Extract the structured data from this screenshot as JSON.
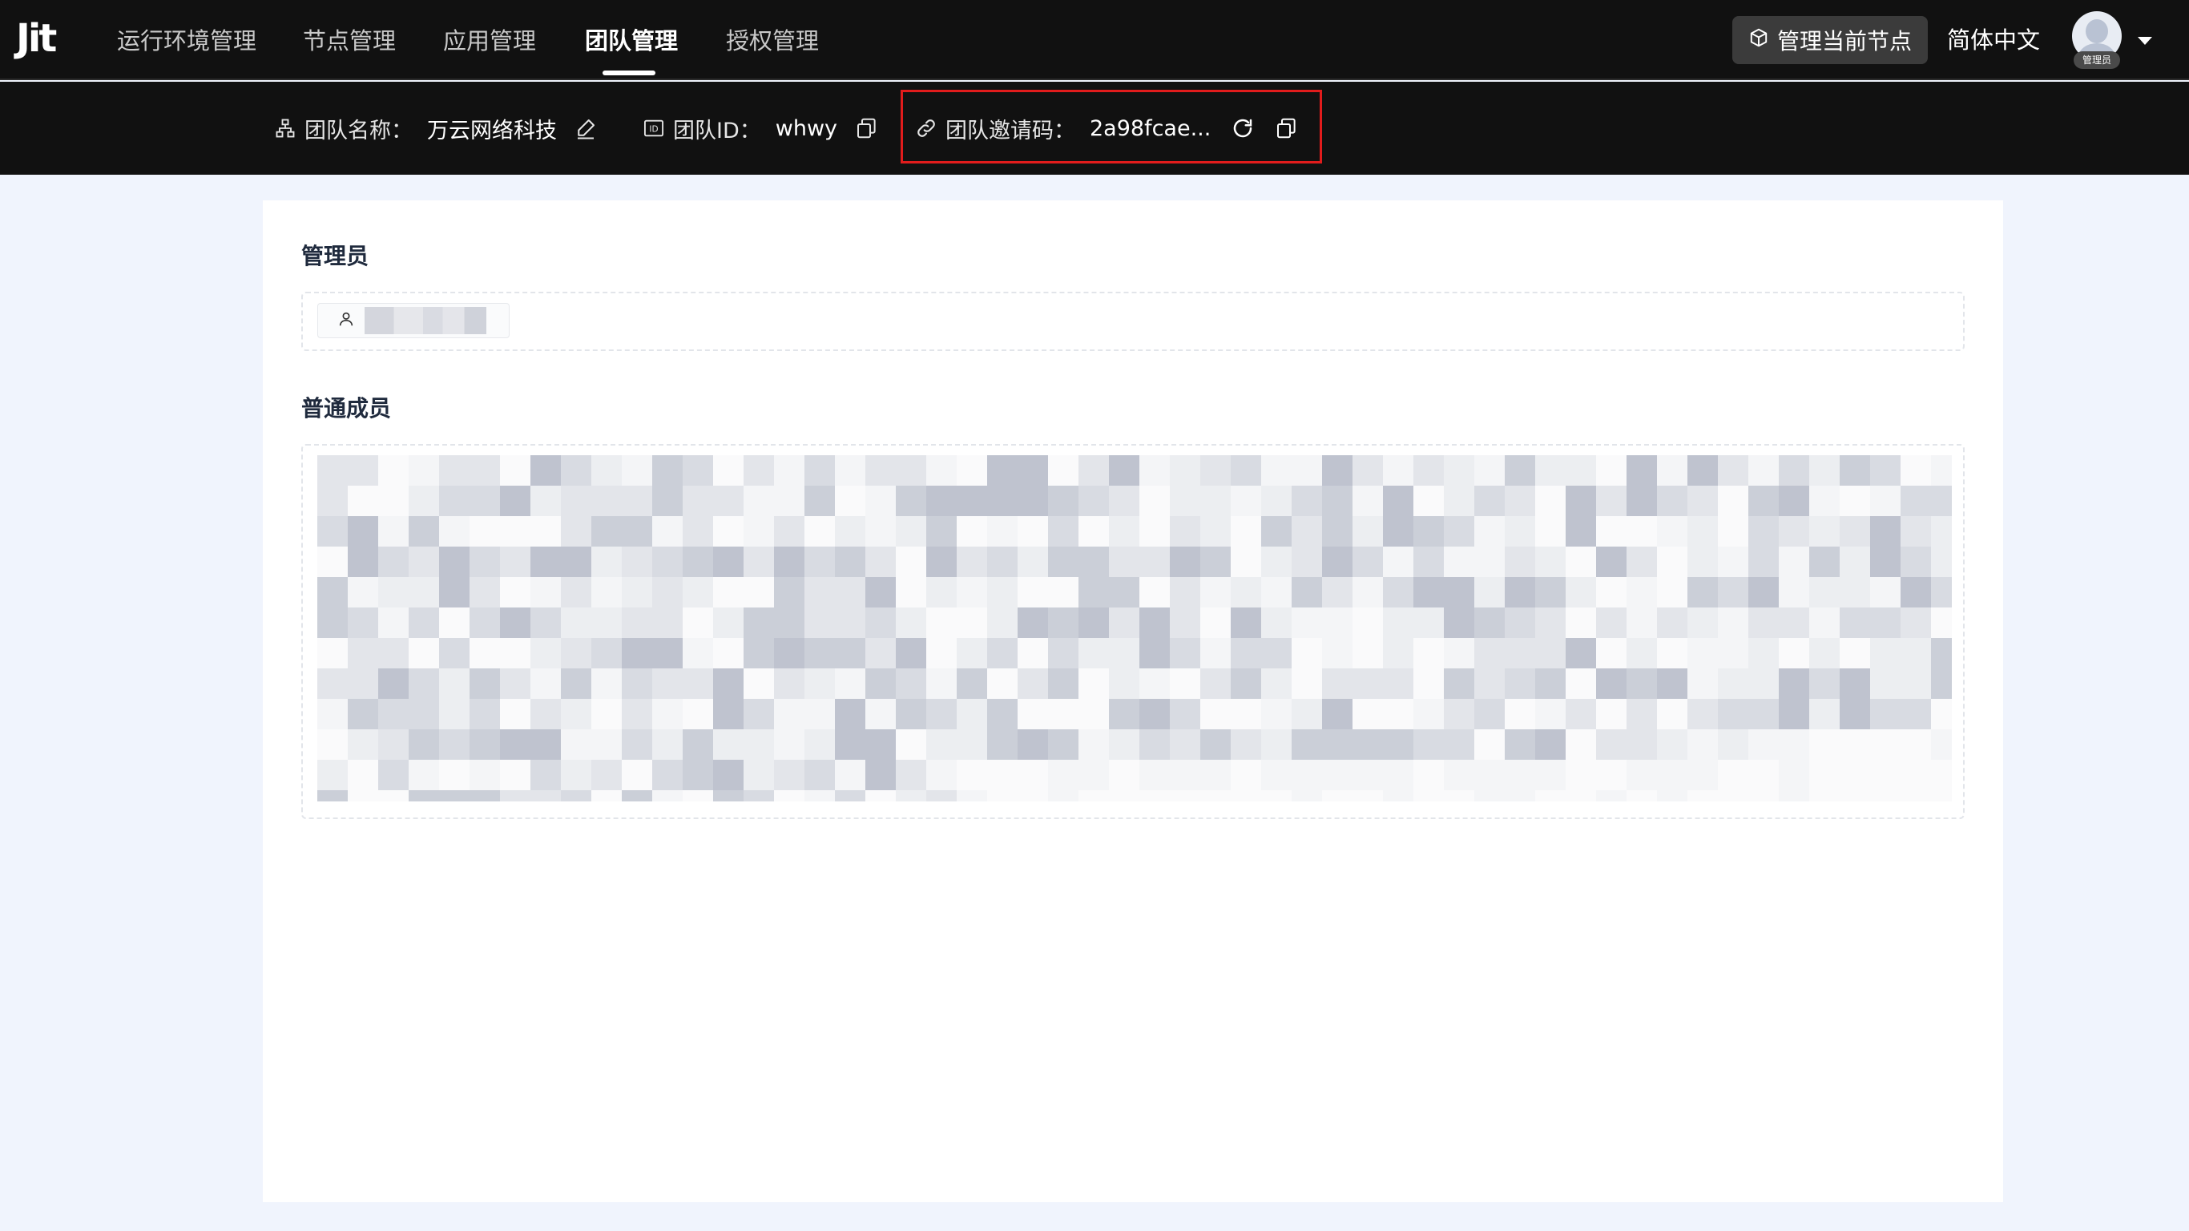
{
  "brand": {
    "logo_text": "Jit"
  },
  "nav": {
    "items": [
      {
        "label": "运行环境管理",
        "active": false
      },
      {
        "label": "节点管理",
        "active": false
      },
      {
        "label": "应用管理",
        "active": false
      },
      {
        "label": "团队管理",
        "active": true
      },
      {
        "label": "授权管理",
        "active": false
      }
    ],
    "manage_node_button": {
      "label": "管理当前节点",
      "icon": "cube-icon"
    },
    "language": "简体中文",
    "user": {
      "badge": "管理员",
      "icon": "avatar-icon",
      "menu_icon": "caret-down-icon"
    }
  },
  "team_info": {
    "name": {
      "label": "团队名称：",
      "value": "万云网络科技",
      "icon": "org-chart-icon",
      "action_icon": "edit-icon"
    },
    "id": {
      "label": "团队ID：",
      "value": "whwy",
      "icon": "id-card-icon",
      "action_icon": "copy-icon"
    },
    "invite": {
      "label": "团队邀请码：",
      "value": "2a98fcae...",
      "icon": "link-icon",
      "action_icons": [
        "refresh-icon",
        "copy-icon"
      ],
      "highlight_color": "#e11c1c"
    }
  },
  "members": {
    "admin_section_title": "管理员",
    "admin_icon": "user-icon",
    "members_section_title": "普通成员"
  },
  "colors": {
    "topbar_bg": "#111111",
    "page_bg": "#f0f4fd",
    "card_bg": "#ffffff",
    "highlight": "#e11c1c"
  }
}
